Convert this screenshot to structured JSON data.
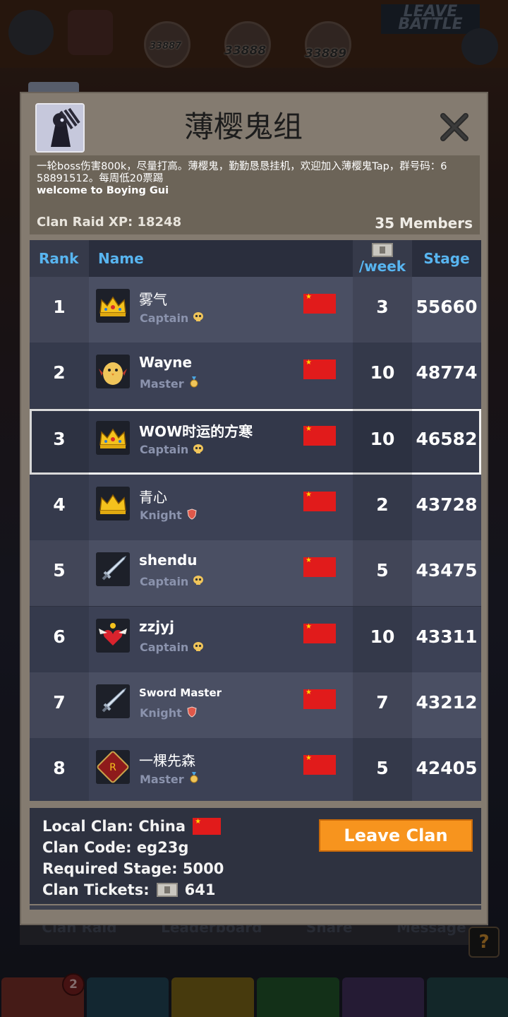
{
  "background": {
    "stages": [
      "33887",
      "33888",
      "33889"
    ],
    "leave_battle": "LEAVE BATTLE",
    "bottom_tabs_badge": "2",
    "underbar_tabs": [
      "Clan Raid",
      "Leaderboard",
      "Share",
      "Message"
    ],
    "help_label": "?"
  },
  "clan": {
    "title": "薄樱鬼组",
    "description_lines": [
      "一轮boss伤害800k，尽量打高。薄樱鬼，勤勤恳恳挂机，欢迎加入薄樱鬼Tap，群号码：6",
      "58891512。每周低20票踢",
      "welcome to Boying Gui"
    ],
    "raid_xp": "Clan Raid XP: 18248",
    "members": "35 Members"
  },
  "table": {
    "headers": {
      "rank": "Rank",
      "name": "Name",
      "week": "/week",
      "stage": "Stage"
    },
    "rows": [
      {
        "rank": "1",
        "name": "雾气",
        "role": "Captain",
        "role_icon": "captain-skull-icon",
        "avatar": "crown-gold-icon",
        "week": "3",
        "stage": "55660"
      },
      {
        "rank": "2",
        "name": "Wayne",
        "role": "Master",
        "role_icon": "master-medal-icon",
        "avatar": "chick-icon",
        "week": "10",
        "stage": "48774"
      },
      {
        "rank": "3",
        "name": "WOW时运的方寒",
        "role": "Captain",
        "role_icon": "captain-skull-icon",
        "avatar": "crown-gold-icon",
        "week": "10",
        "stage": "46582"
      },
      {
        "rank": "4",
        "name": "青心",
        "role": "Knight",
        "role_icon": "knight-shield-icon",
        "avatar": "crown-plain-icon",
        "week": "2",
        "stage": "43728"
      },
      {
        "rank": "5",
        "name": "shendu",
        "role": "Captain",
        "role_icon": "captain-skull-icon",
        "avatar": "sword-icon",
        "week": "5",
        "stage": "43475"
      },
      {
        "rank": "6",
        "name": "zzjyj",
        "role": "Captain",
        "role_icon": "captain-skull-icon",
        "avatar": "winged-heart-icon",
        "week": "10",
        "stage": "43311"
      },
      {
        "rank": "7",
        "name": "Sword Master",
        "role": "Knight",
        "role_icon": "knight-shield-icon",
        "avatar": "sword-icon",
        "week": "7",
        "stage": "43212"
      },
      {
        "rank": "8",
        "name": "一棵先森",
        "role": "Master",
        "role_icon": "master-medal-icon",
        "avatar": "red-tome-icon",
        "week": "5",
        "stage": "42405"
      }
    ],
    "highlight_rank": "3"
  },
  "footer": {
    "local_clan": "Local Clan: China",
    "clan_code": "Clan Code: eg23g",
    "required_stage": "Required Stage: 5000",
    "clan_tickets_label": "Clan Tickets:",
    "clan_tickets_value": "641",
    "leave_button": "Leave Clan"
  },
  "colors": {
    "header_text": "#58b5f0",
    "leave_button": "#f7941e",
    "flag": "#e11b1b"
  }
}
